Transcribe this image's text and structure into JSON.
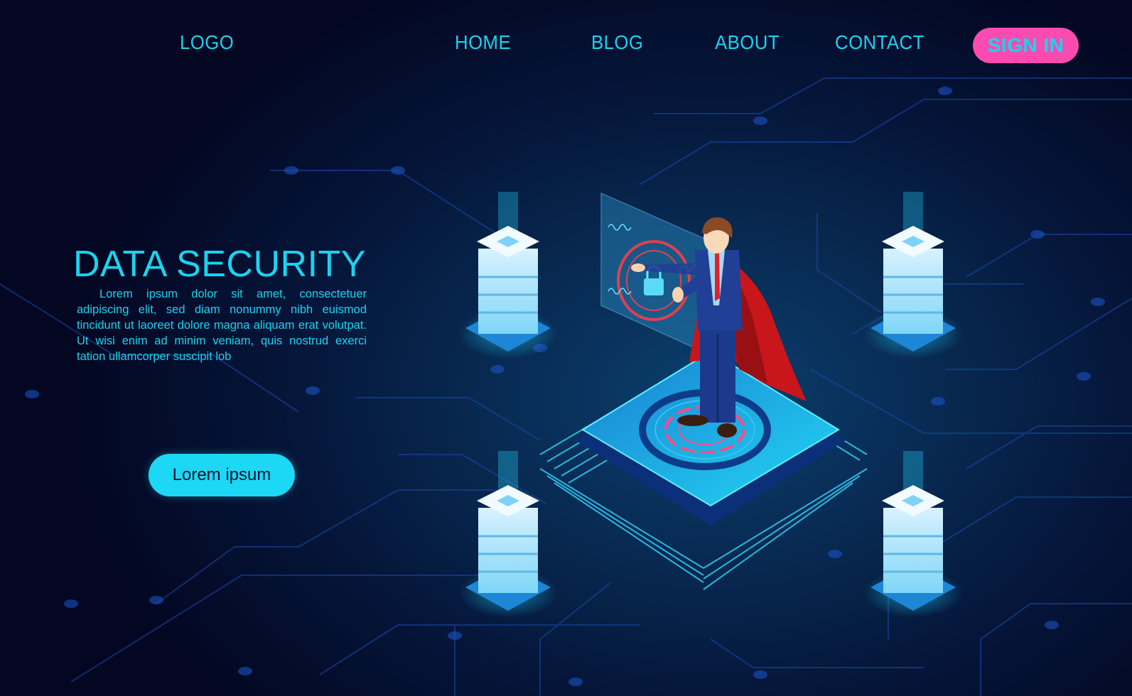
{
  "nav": {
    "logo": "LOGO",
    "links": [
      "HOME",
      "BLOG",
      "ABOUT",
      "CONTACT"
    ],
    "sign_in": "SIGN IN"
  },
  "hero": {
    "title": "DATA SECURITY",
    "body": "Lorem ipsum dolor sit amet, consectetuer adipiscing elit, sed diam nonummy nibh euismod tincidunt ut laoreet dolore magna aliquam erat volutpat. Ut wisi enim ad minim veniam, quis nostrud exerci tation ullamcorper suscipit lob",
    "cta_label": "Lorem ipsum"
  },
  "colors": {
    "accent_cyan": "#1ad3ef",
    "sign_in_pink": "#fb4bb0",
    "cape_red": "#c8161c",
    "background": "#030722"
  }
}
